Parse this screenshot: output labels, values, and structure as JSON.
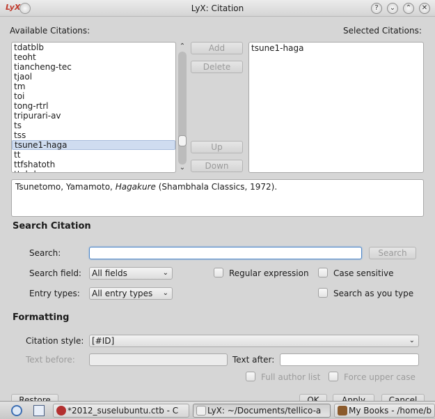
{
  "window": {
    "title": "LyX: Citation",
    "logo": "LyX",
    "controls": [
      "help-icon",
      "minimize-icon",
      "maximize-icon",
      "close-icon"
    ],
    "control_glyphs": {
      "help": "?",
      "minimize": "⌄",
      "maximize": "⌃",
      "close": "✕"
    }
  },
  "available": {
    "label": "Available Citations:",
    "items": [
      "tdatblb",
      "teoht",
      "tiancheng-tec",
      "tjaol",
      "tm",
      "toi",
      "tong-rtrl",
      "tripurari-av",
      "ts",
      "tss",
      "tsune1-haga",
      "tt",
      "ttfshatoth",
      "ttybd"
    ],
    "selected_item": "tsune1-haga"
  },
  "selected": {
    "label": "Selected Citations:",
    "items": [
      "tsune1-haga"
    ]
  },
  "buttons": {
    "add": "Add",
    "delete": "Delete",
    "up": "Up",
    "down": "Down",
    "search": "Search",
    "restore": "Restore",
    "ok": "OK",
    "apply": "Apply",
    "cancel": "Cancel"
  },
  "info": {
    "prefix": "Tsunetomo, Yamamoto, ",
    "title": "Hagakure",
    "suffix": " (Shambhala Classics, 1972)."
  },
  "search_citation": {
    "heading": "Search Citation",
    "search_label": "Search:",
    "search_value": "",
    "field_label": "Search field:",
    "field_value": "All fields",
    "types_label": "Entry types:",
    "types_value": "All entry types",
    "regex_label": "Regular expression",
    "case_label": "Case sensitive",
    "as_you_type_label": "Search as you type"
  },
  "formatting": {
    "heading": "Formatting",
    "style_label": "Citation style:",
    "style_value": "[#ID]",
    "before_label": "Text before:",
    "after_label": "Text after:",
    "full_author_label": "Full author list",
    "force_upper_label": "Force upper case"
  },
  "taskbar": {
    "tasks": [
      {
        "label": "*2012_suselubuntu.ctb - C",
        "active": false
      },
      {
        "label": "LyX: ~/Documents/tellico-a",
        "active": true
      },
      {
        "label": "My Books - /home/b",
        "active": false
      }
    ]
  }
}
